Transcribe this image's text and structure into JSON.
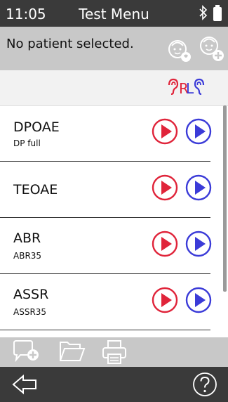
{
  "status": {
    "time": "11:05",
    "title": "Test Menu"
  },
  "patient": {
    "text": "No patient selected."
  },
  "ears": {
    "right": "R",
    "left": "L"
  },
  "tests": [
    {
      "name": "DPOAE",
      "sub": "DP full"
    },
    {
      "name": "TEOAE",
      "sub": ""
    },
    {
      "name": "ABR",
      "sub": "ABR35"
    },
    {
      "name": "ASSR",
      "sub": "ASSR35"
    }
  ],
  "colors": {
    "right": "#e0243a",
    "left": "#3b3bd8"
  },
  "icons": {
    "status": [
      "bluetooth-icon",
      "battery-icon"
    ],
    "patient": [
      "select-patient-icon",
      "add-patient-icon"
    ],
    "toolbar": [
      "add-comment-icon",
      "folder-icon",
      "print-icon"
    ],
    "nav": [
      "back-arrow-icon",
      "help-icon"
    ]
  }
}
